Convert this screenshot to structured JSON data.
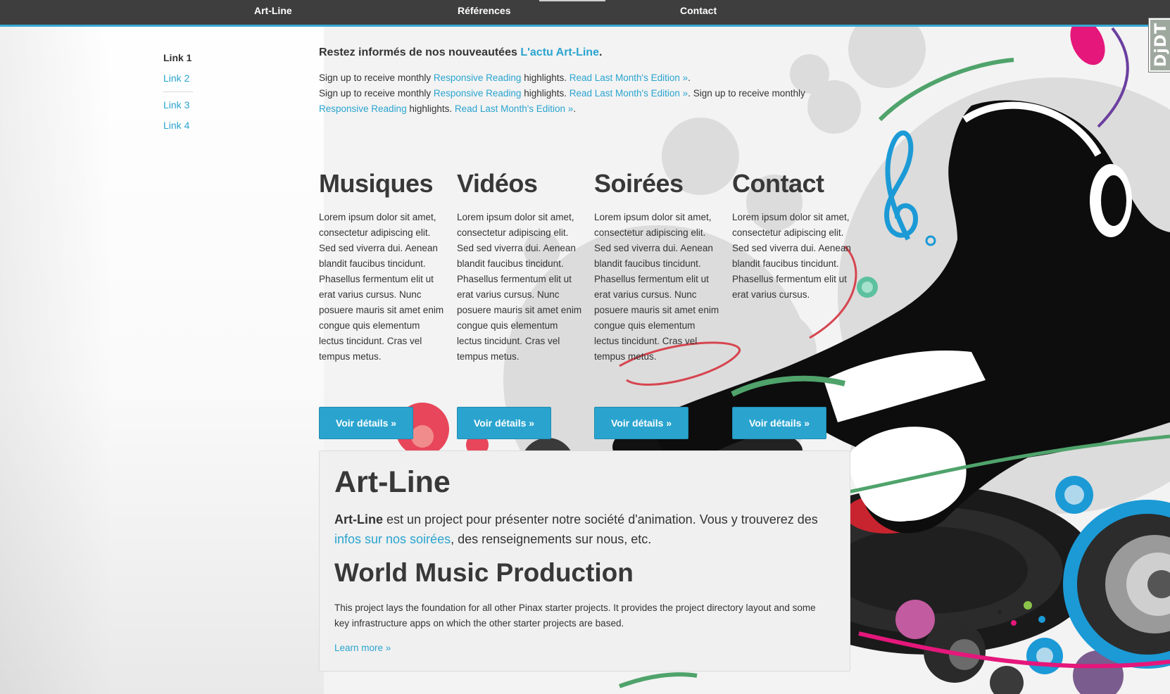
{
  "nav": {
    "items": [
      "Art-Line",
      "Références",
      "Contact"
    ]
  },
  "badge": "DjDT",
  "sidebar": {
    "items": [
      "Link 1",
      "Link 2",
      "Link 3",
      "Link 4"
    ]
  },
  "intro": {
    "title_prefix": "Restez informés de nos nouveautées ",
    "title_link": "L'actu Art-Line",
    "title_suffix": ".",
    "signup": "Sign up to receive monthly ",
    "reading_link": "Responsive Reading",
    "highlights": " highlights. ",
    "edition_link": "Read Last Month's Edition »",
    "period": ".",
    "period_space": ". "
  },
  "columns": [
    {
      "title": "Musiques",
      "text": "Lorem ipsum dolor sit amet, consectetur adipiscing elit. Sed sed viverra dui. Aenean blandit faucibus tincidunt. Phasellus fermentum elit ut erat varius cursus. Nunc posuere mauris sit amet enim congue quis elementum lectus tincidunt. Cras vel tempus metus.",
      "button": "Voir détails »"
    },
    {
      "title": "Vidéos",
      "text": "Lorem ipsum dolor sit amet, consectetur adipiscing elit. Sed sed viverra dui. Aenean blandit faucibus tincidunt. Phasellus fermentum elit ut erat varius cursus. Nunc posuere mauris sit amet enim congue quis elementum lectus tincidunt. Cras vel tempus metus.",
      "button": "Voir détails »"
    },
    {
      "title": "Soirées",
      "text": "Lorem ipsum dolor sit amet, consectetur adipiscing elit. Sed sed viverra dui. Aenean blandit faucibus tincidunt. Phasellus fermentum elit ut erat varius cursus. Nunc posuere mauris sit amet enim congue quis elementum lectus tincidunt. Cras vel tempus metus.",
      "button": "Voir détails »"
    },
    {
      "title": "Contact",
      "text": "Lorem ipsum dolor sit amet, consectetur adipiscing elit. Sed sed viverra dui. Aenean blandit faucibus tincidunt. Phasellus fermentum elit ut erat varius cursus.",
      "button": "Voir détails »"
    }
  ],
  "hero": {
    "title": "Art-Line",
    "lead_bold": "Art-Line",
    "lead_text": " est un project pour présenter notre société d'animation. Vous y trouverez des ",
    "lead_link": "infos sur nos soirées",
    "lead_end": ", des renseignements sur nous, etc.",
    "subtitle": "World Music Production",
    "text": "This project lays the foundation for all other Pinax starter projects. It provides the project directory layout and some key infrastructure apps on which the other starter projects are based.",
    "learn_more": "Learn more »"
  },
  "colors": {
    "accent": "#2aa4cf",
    "navbar": "#3e3e3e",
    "nav_border": "#37a9d6",
    "hero_bg": "#f0f0f0"
  }
}
